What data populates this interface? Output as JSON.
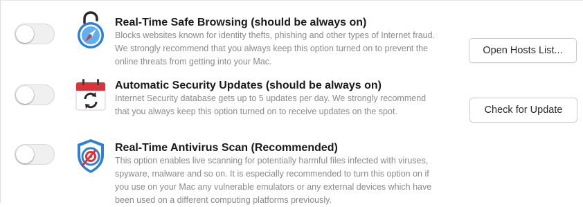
{
  "colors": {
    "title": "#1a1a1a",
    "description": "#8a8a8a",
    "toggle_off": "#f0f0f0",
    "accent_blue": "#2f7fd6",
    "accent_red": "#d9343a"
  },
  "features": [
    {
      "title": "Real-Time Safe Browsing (should be always on)",
      "description": [
        "Blocks websites known for identity thefts, phishing and other types of Internet fraud.",
        "We strongly recommend that you always keep this option turned on to prevent the",
        "online threats from getting into your Mac."
      ],
      "icon": "safe-browsing-compass-lock-icon",
      "enabled": false,
      "button_label": "Open Hosts List..."
    },
    {
      "title": "Automatic Security Updates (should be always on)",
      "description": [
        "Internet Security database gets up to 5 updates per day. We strongly recommend",
        "that you always keep this option turned on to receive updates on the spot."
      ],
      "icon": "calendar-update-icon",
      "enabled": false,
      "button_label": "Check for Update"
    },
    {
      "title": "Real-Time Antivirus Scan (Recommended)",
      "description": [
        "This option enables live scanning for potentially harmful files infected with viruses,",
        "spyware, malware and so on. It is especially recommended to turn this option on if",
        "you use on your Mac any vulnerable emulators or any external devices which have",
        "been used on a different computing platforms previously."
      ],
      "icon": "antivirus-shield-icon",
      "enabled": false
    }
  ]
}
